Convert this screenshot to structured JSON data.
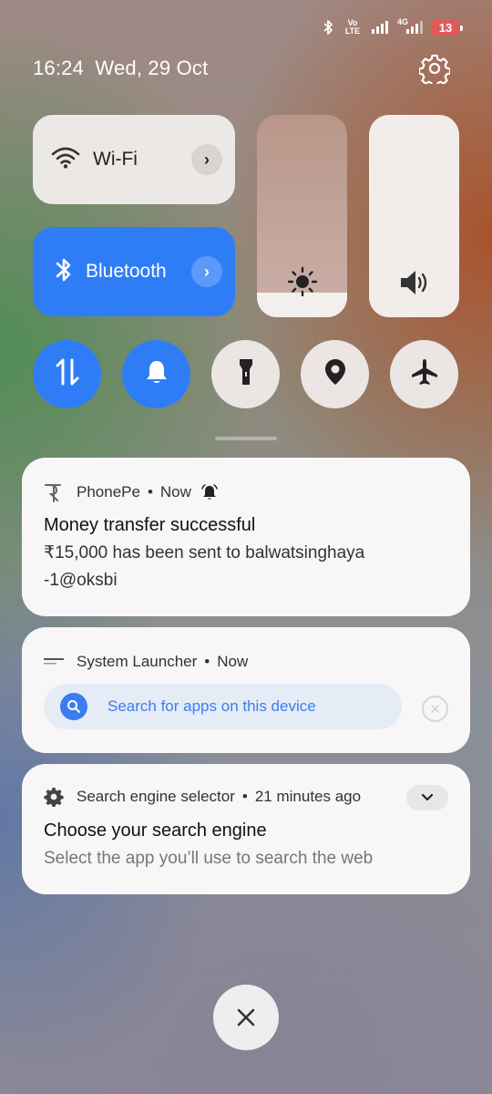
{
  "status_bar": {
    "volte_label": "Vo LTE",
    "network_label": "4G",
    "battery_level": "13",
    "icons": [
      "bluetooth-icon",
      "volte-icon",
      "signal-icon",
      "4g-signal-icon",
      "battery-icon"
    ]
  },
  "header": {
    "time": "16:24",
    "date": "Wed, 29 Oct",
    "settings_icon": "gear-icon"
  },
  "quick_tiles": {
    "wifi": {
      "label": "Wi-Fi",
      "icon": "wifi-icon",
      "active": false
    },
    "bluetooth": {
      "label": "Bluetooth",
      "icon": "bluetooth-icon",
      "active": true
    },
    "brightness": {
      "icon": "sun-icon",
      "level": 0.12
    },
    "volume": {
      "icon": "speaker-icon",
      "level": 0.0
    }
  },
  "toggles": [
    {
      "name": "mobile-data",
      "icon": "data-arrows-icon",
      "active": true
    },
    {
      "name": "ring",
      "icon": "bell-icon",
      "active": true
    },
    {
      "name": "torch",
      "icon": "flashlight-icon",
      "active": false
    },
    {
      "name": "location",
      "icon": "location-icon",
      "active": false
    },
    {
      "name": "airplane-mode",
      "icon": "airplane-icon",
      "active": false
    }
  ],
  "notifications": [
    {
      "app": "PhonePe",
      "time": "Now",
      "title": "Money transfer successful",
      "body_line1": "₹15,000 has been sent to balwatsinghaya",
      "body_line2": "-1@oksbi"
    },
    {
      "app": "System Launcher",
      "time": "Now",
      "search_placeholder": "Search for apps on this device"
    },
    {
      "app": "Search engine selector",
      "time": "21 minutes ago",
      "title": "Choose your search engine",
      "body": "Select the app you’ll use to search the web"
    }
  ],
  "colors": {
    "accent": "#2f7df6",
    "battery_low": "#e05a5a",
    "card": "#f8f6f6"
  }
}
